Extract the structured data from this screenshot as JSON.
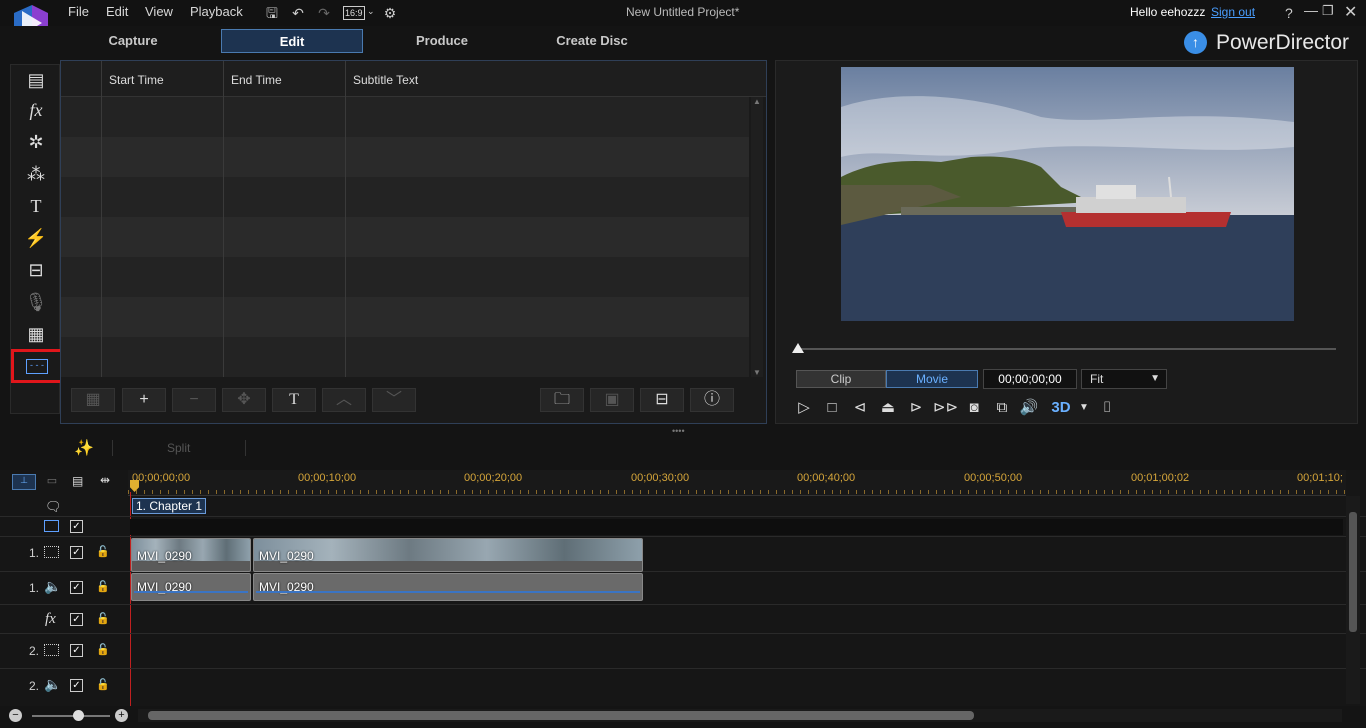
{
  "menu": {
    "file": "File",
    "edit": "Edit",
    "view": "View",
    "playback": "Playback",
    "aspect": "16:9"
  },
  "window": {
    "title": "New Untitled Project*",
    "greeting": "Hello eehozzz",
    "signout": "Sign out",
    "help": "?"
  },
  "modes": {
    "capture": "Capture",
    "edit": "Edit",
    "produce": "Produce",
    "create_disc": "Create Disc"
  },
  "brand": {
    "name": "PowerDirector"
  },
  "subtitle_table": {
    "col_start": "Start Time",
    "col_end": "End Time",
    "col_text": "Subtitle Text"
  },
  "preview": {
    "clip_tab": "Clip",
    "movie_tab": "Movie",
    "timecode": "00;00;00;00",
    "fit": "Fit",
    "stereo": "3D"
  },
  "edit_tools": {
    "split": "Split"
  },
  "ruler": [
    "00;00;00;00",
    "00;00;10;00",
    "00;00;20;00",
    "00;00;30;00",
    "00;00;40;00",
    "00;00;50;00",
    "00;01;00;02",
    "00;01;10;"
  ],
  "chapter": {
    "label": "1. Chapter 1"
  },
  "tracks": {
    "v1": "1.",
    "a1": "1.",
    "v2": "2.",
    "a2": "2.",
    "fx": "fx"
  },
  "clips": {
    "video_a": "MVI_0290",
    "video_b": "MVI_0290",
    "audio_a": "MVI_0290",
    "audio_b": "MVI_0290"
  },
  "colors": {
    "accent": "#4a7ab0",
    "highlight_box": "#e0161b",
    "ruler_text": "#d6a63a"
  }
}
